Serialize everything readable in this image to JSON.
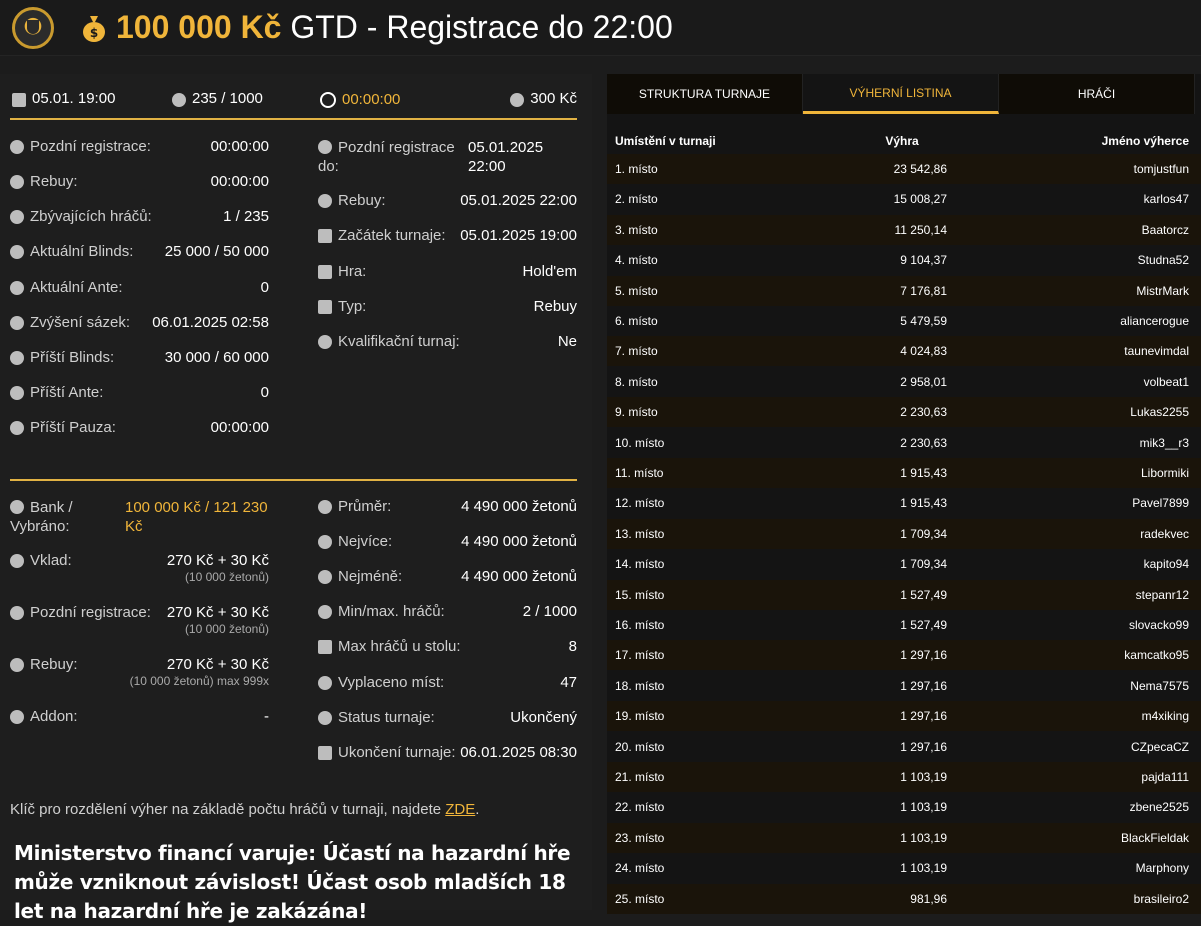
{
  "header": {
    "amount": "100 000 Kč",
    "rest": "GTD - Registrace do 22:00"
  },
  "topstats": {
    "date": "05.01. 19:00",
    "players": "235 / 1000",
    "timer": "00:00:00",
    "buyin": "300 Kč"
  },
  "left_col1": [
    {
      "label": "Pozdní registrace:",
      "value": "00:00:00"
    },
    {
      "label": "Rebuy:",
      "value": "00:00:00"
    },
    {
      "label": "Zbývajících hráčů:",
      "value": "1 / 235"
    },
    {
      "label": "Aktuální Blinds:",
      "value": "25 000 / 50 000"
    },
    {
      "label": "Aktuální Ante:",
      "value": "0"
    },
    {
      "label": "Zvýšení sázek:",
      "value": "06.01.2025 02:58"
    },
    {
      "label": "Příští Blinds:",
      "value": "30 000 / 60 000"
    },
    {
      "label": "Příští Ante:",
      "value": "0"
    },
    {
      "label": "Příští Pauza:",
      "value": "00:00:00"
    }
  ],
  "left_col2": {
    "late_reg_label1": "Pozdní registrace",
    "late_reg_label2": "do:",
    "late_reg_value1": "05.01.2025",
    "late_reg_value2": "22:00",
    "rows": [
      {
        "label": "Rebuy:",
        "value": "05.01.2025 22:00"
      },
      {
        "label": "Začátek turnaje:",
        "value": "05.01.2025 19:00"
      },
      {
        "label": "Hra:",
        "value": "Hold'em"
      },
      {
        "label": "Typ:",
        "value": "Rebuy"
      },
      {
        "label": "Kvalifikační turnaj:",
        "value": "Ne"
      }
    ]
  },
  "bottom_col1": {
    "bank_label1": "Bank /",
    "bank_label2": "Vybráno:",
    "bank_value1": "100 000 Kč / 121 230",
    "bank_value2": "Kč",
    "vklad_label": "Vklad:",
    "vklad_value": "270 Kč + 30 Kč",
    "vklad_sub": "(10 000 žetonů)",
    "late_label": "Pozdní registrace:",
    "late_value": "270 Kč + 30 Kč",
    "late_sub": "(10 000 žetonů)",
    "rebuy_label": "Rebuy:",
    "rebuy_value": "270 Kč + 30 Kč",
    "rebuy_sub": "(10 000 žetonů) max 999x",
    "addon_label": "Addon:",
    "addon_value": "-"
  },
  "bottom_col2": [
    {
      "label": "Průměr:",
      "value": "4 490 000 žetonů"
    },
    {
      "label": "Nejvíce:",
      "value": "4 490 000 žetonů"
    },
    {
      "label": "Nejméně:",
      "value": "4 490 000 žetonů"
    },
    {
      "label": "Min/max. hráčů:",
      "value": "2 / 1000"
    },
    {
      "label": "Max hráčů u stolu:",
      "value": "8"
    },
    {
      "label": "Vyplaceno míst:",
      "value": "47"
    },
    {
      "label": "Status turnaje:",
      "value": "Ukončený"
    },
    {
      "label": "Ukončení turnaje:",
      "value": "06.01.2025 08:30"
    }
  ],
  "footer": {
    "key_text": "Klíč pro rozdělení výher na základě počtu hráčů v turnaji, najdete",
    "key_link": "ZDE",
    "key_end": ".",
    "warning": "Ministerstvo financí varuje: Účastí na hazardní hře může vzniknout závislost! Účast osob mladších 18 let na hazardní hře je zakázána!"
  },
  "tabs": [
    "STRUKTURA TURNAJE",
    "VÝHERNÍ LISTINA",
    "HRÁČI"
  ],
  "table": {
    "headers": [
      "Umístění v turnaji",
      "Výhra",
      "Jméno výherce"
    ],
    "rows": [
      [
        "1. místo",
        "23 542,86",
        "tomjustfun"
      ],
      [
        "2. místo",
        "15 008,27",
        "karlos47"
      ],
      [
        "3. místo",
        "11 250,14",
        "Baatorcz"
      ],
      [
        "4. místo",
        "9 104,37",
        "Studna52"
      ],
      [
        "5. místo",
        "7 176,81",
        "MistrMark"
      ],
      [
        "6. místo",
        "5 479,59",
        "aliancerogue"
      ],
      [
        "7. místo",
        "4 024,83",
        "taunevimdal"
      ],
      [
        "8. místo",
        "2 958,01",
        "volbeat1"
      ],
      [
        "9. místo",
        "2 230,63",
        "Lukas2255"
      ],
      [
        "10. místo",
        "2 230,63",
        "mik3__r3"
      ],
      [
        "11. místo",
        "1 915,43",
        "Libormiki"
      ],
      [
        "12. místo",
        "1 915,43",
        "Pavel7899"
      ],
      [
        "13. místo",
        "1 709,34",
        "radekvec"
      ],
      [
        "14. místo",
        "1 709,34",
        "kapito94"
      ],
      [
        "15. místo",
        "1 527,49",
        "stepanr12"
      ],
      [
        "16. místo",
        "1 527,49",
        "slovacko99"
      ],
      [
        "17. místo",
        "1 297,16",
        "kamcatko95"
      ],
      [
        "18. místo",
        "1 297,16",
        "Nema7575"
      ],
      [
        "19. místo",
        "1 297,16",
        "m4xiking"
      ],
      [
        "20. místo",
        "1 297,16",
        "CZpecaCZ"
      ],
      [
        "21. místo",
        "1 103,19",
        "pajda111"
      ],
      [
        "22. místo",
        "1 103,19",
        "zbene2525"
      ],
      [
        "23. místo",
        "1 103,19",
        "BlackFieldak"
      ],
      [
        "24. místo",
        "1 103,19",
        "Marphony"
      ],
      [
        "25. místo",
        "981,96",
        "brasileiro2"
      ]
    ]
  }
}
